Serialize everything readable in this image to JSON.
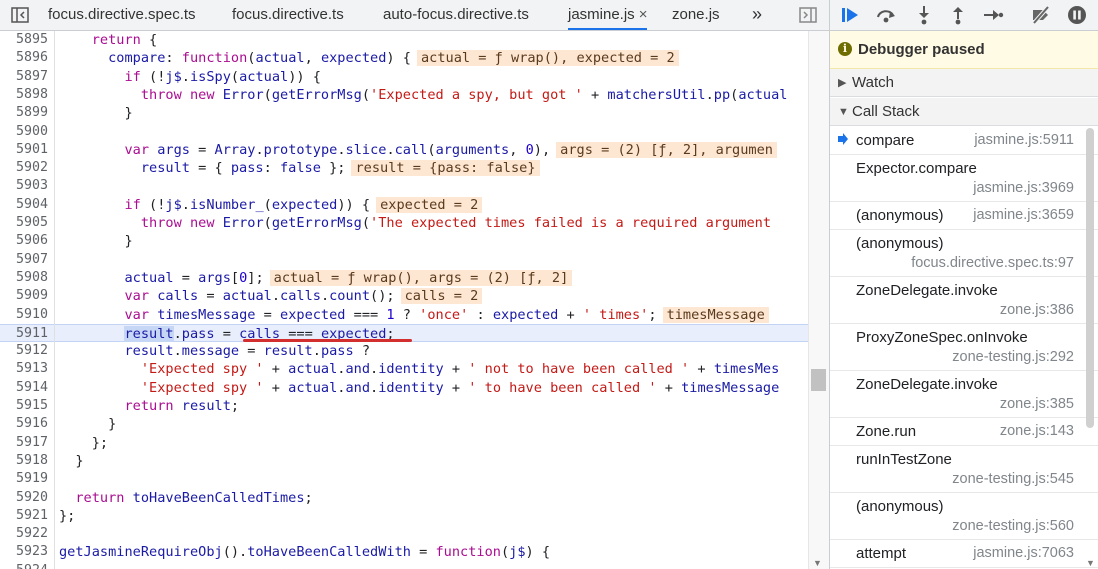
{
  "tabs": [
    {
      "label": "focus.directive.spec.ts"
    },
    {
      "label": "focus.directive.ts"
    },
    {
      "label": "auto-focus.directive.ts"
    },
    {
      "label": "jasmine.js",
      "active": true,
      "close": "×"
    },
    {
      "label": "zone.js"
    }
  ],
  "more_tabs": "»",
  "code_lines": [
    {
      "n": "5895",
      "text": "    return {"
    },
    {
      "n": "5896",
      "text": "      compare: function(actual, expected) {",
      "val": "actual = ƒ wrap(), expected = 2"
    },
    {
      "n": "5897",
      "text": "        if (!j$.isSpy(actual)) {"
    },
    {
      "n": "5898",
      "text": "          throw new Error(getErrorMsg('Expected a spy, but got ' + matchersUtil.pp(actual"
    },
    {
      "n": "5899",
      "text": "        }"
    },
    {
      "n": "5900",
      "text": ""
    },
    {
      "n": "5901",
      "text": "        var args = Array.prototype.slice.call(arguments, 0),",
      "val": "args = (2) [ƒ, 2], argumen"
    },
    {
      "n": "5902",
      "text": "          result = { pass: false };",
      "val": "result = {pass: false}"
    },
    {
      "n": "5903",
      "text": ""
    },
    {
      "n": "5904",
      "text": "        if (!j$.isNumber_(expected)) {",
      "val": "expected = 2"
    },
    {
      "n": "5905",
      "text": "          throw new Error(getErrorMsg('The expected times failed is a required argument"
    },
    {
      "n": "5906",
      "text": "        }"
    },
    {
      "n": "5907",
      "text": ""
    },
    {
      "n": "5908",
      "text": "        actual = args[0];",
      "val": "actual = ƒ wrap(), args = (2) [ƒ, 2]"
    },
    {
      "n": "5909",
      "text": "        var calls = actual.calls.count();",
      "val": "calls = 2"
    },
    {
      "n": "5910",
      "text": "        var timesMessage = expected === 1 ? 'once' : expected + ' times';",
      "val": "timesMessage"
    },
    {
      "n": "5911",
      "text": "        result.pass = calls === expected;",
      "exec": true
    },
    {
      "n": "5912",
      "text": "        result.message = result.pass ?"
    },
    {
      "n": "5913",
      "text": "          'Expected spy ' + actual.and.identity + ' not to have been called ' + timesMes"
    },
    {
      "n": "5914",
      "text": "          'Expected spy ' + actual.and.identity + ' to have been called ' + timesMessage"
    },
    {
      "n": "5915",
      "text": "        return result;"
    },
    {
      "n": "5916",
      "text": "      }"
    },
    {
      "n": "5917",
      "text": "    };"
    },
    {
      "n": "5918",
      "text": "  }"
    },
    {
      "n": "5919",
      "text": ""
    },
    {
      "n": "5920",
      "text": "  return toHaveBeenCalledTimes;"
    },
    {
      "n": "5921",
      "text": "};"
    },
    {
      "n": "5922",
      "text": ""
    },
    {
      "n": "5923",
      "text": "getJasmineRequireObj().toHaveBeenCalledWith = function(j$) {"
    },
    {
      "n": "5924",
      "text": ""
    }
  ],
  "debugger": {
    "paused_icon": "i",
    "paused_text": "Debugger paused",
    "watch_label": "Watch",
    "callstack_label": "Call Stack",
    "frames": [
      {
        "name": "compare",
        "loc": "jasmine.js:5911",
        "current": true
      },
      {
        "name": "Expector.compare",
        "loc": "jasmine.js:3969",
        "twoline": true
      },
      {
        "name": "(anonymous)",
        "loc": "jasmine.js:3659"
      },
      {
        "name": "(anonymous)",
        "loc": "focus.directive.spec.ts:97",
        "twoline": true
      },
      {
        "name": "ZoneDelegate.invoke",
        "loc": "zone.js:386",
        "twoline": true
      },
      {
        "name": "ProxyZoneSpec.onInvoke",
        "loc": "zone-testing.js:292",
        "twoline": true
      },
      {
        "name": "ZoneDelegate.invoke",
        "loc": "zone.js:385",
        "twoline": true
      },
      {
        "name": "Zone.run",
        "loc": "zone.js:143"
      },
      {
        "name": "runInTestZone",
        "loc": "zone-testing.js:545",
        "twoline": true
      },
      {
        "name": "(anonymous)",
        "loc": "zone-testing.js:560",
        "twoline": true
      },
      {
        "name": "attempt",
        "loc": "jasmine.js:7063"
      }
    ]
  },
  "colors": {
    "keyword": "#aa0d91",
    "string": "#c41a16",
    "number": "#1c00cf",
    "identifier": "#1a1aa6",
    "accent": "#1a73e8"
  }
}
